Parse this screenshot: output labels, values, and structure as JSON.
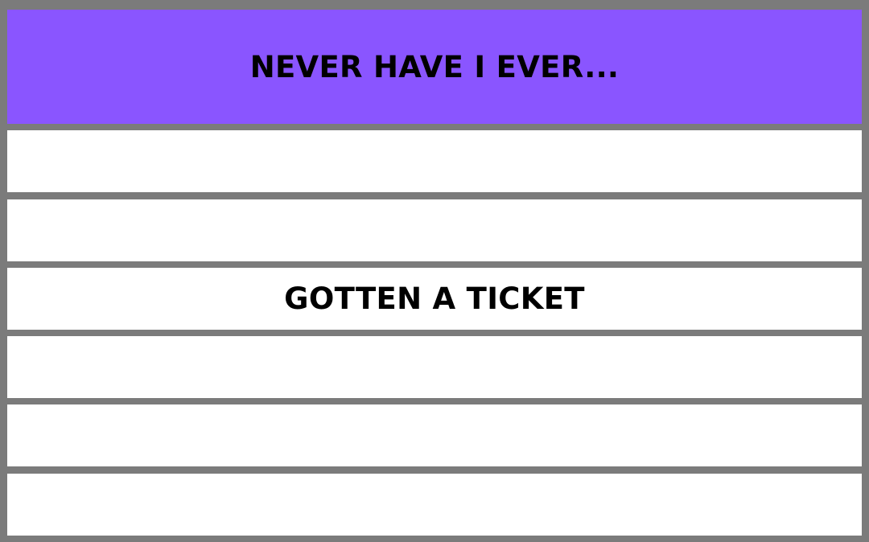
{
  "colors": {
    "border": "#7b7b7b",
    "header_bg": "#8a55ff",
    "row_bg": "#ffffff",
    "text": "#000000"
  },
  "header": {
    "title": "NEVER HAVE I EVER..."
  },
  "rows": [
    {
      "text": ""
    },
    {
      "text": ""
    },
    {
      "text": "GOTTEN A TICKET"
    },
    {
      "text": ""
    },
    {
      "text": ""
    },
    {
      "text": ""
    }
  ]
}
